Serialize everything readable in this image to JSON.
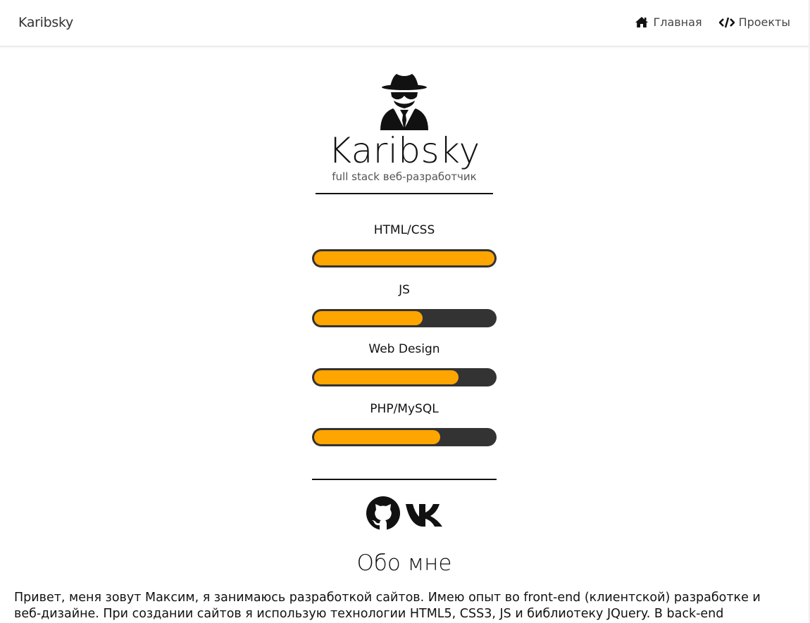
{
  "navbar": {
    "brand": "Karibsky",
    "links": [
      {
        "label": "Главная",
        "icon": "home-icon"
      },
      {
        "label": "Проекты",
        "icon": "code-icon"
      }
    ]
  },
  "hero": {
    "icon": "user-secret-icon",
    "name": "Karibsky",
    "subtitle": "full stack веб-разработчик"
  },
  "skills": [
    {
      "label": "HTML/CSS",
      "percent": 100
    },
    {
      "label": "JS",
      "percent": 60
    },
    {
      "label": "Web Design",
      "percent": 80
    },
    {
      "label": "PHP/MySQL",
      "percent": 70
    }
  ],
  "colors": {
    "accent": "#ffa500",
    "bar_track": "#333333"
  },
  "socials": [
    {
      "icon": "github-icon"
    },
    {
      "icon": "vk-icon"
    }
  ],
  "about": {
    "title": "Обо мне",
    "text": "Привет, меня зовут Максим, я занимаюсь разработкой сайтов. Имею опыт во front-end (клиентской) разработке и веб-дизайне. При создании сайтов я использую технологии HTML5, CSS3, JS и библиотеку JQuery. В back-end (серверной)"
  }
}
